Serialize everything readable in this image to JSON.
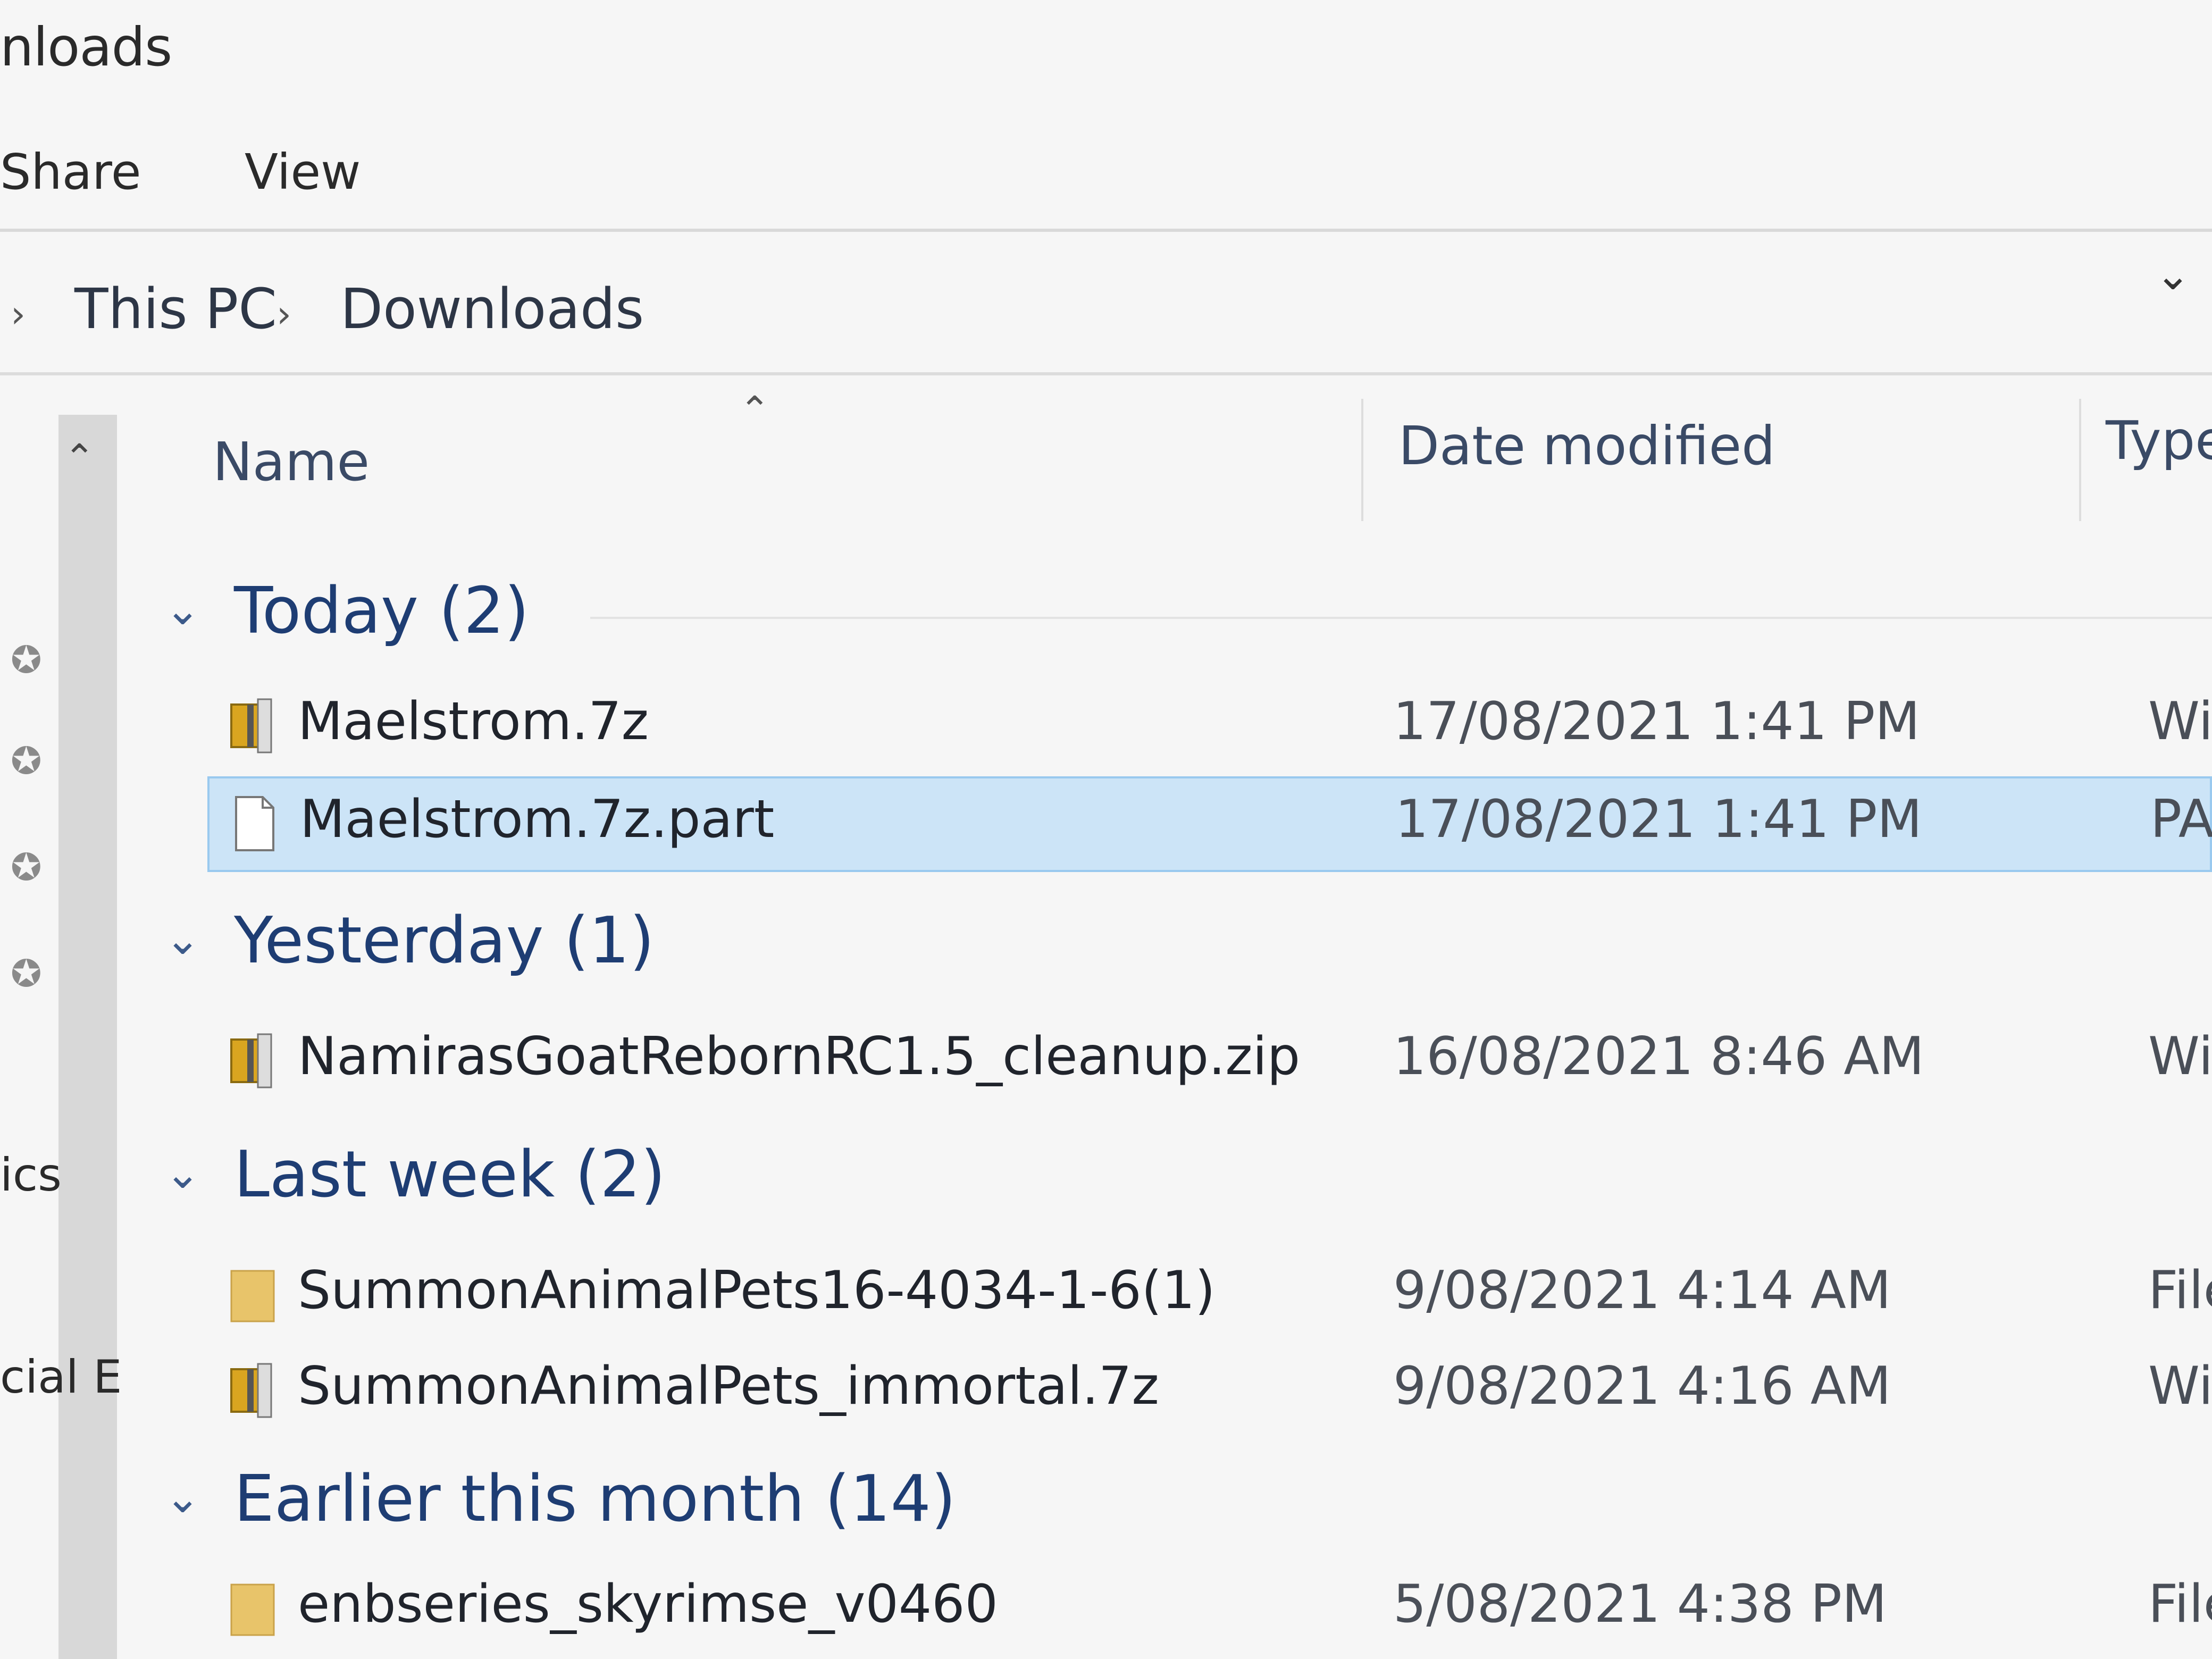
{
  "window": {
    "title": "nloads"
  },
  "ribbon": {
    "tabs": [
      "Share",
      "View"
    ]
  },
  "address": {
    "crumbs": [
      "This PC",
      "Downloads"
    ]
  },
  "nav": {
    "items": [
      "ics",
      "cial E"
    ]
  },
  "columns": {
    "name": "Name",
    "date": "Date modified",
    "type": "Type"
  },
  "groups": [
    {
      "label": "Today (2)",
      "files": [
        {
          "name": "Maelstrom.7z",
          "date": "17/08/2021 1:41 PM",
          "type": "WinZ",
          "icon": "archive-icon",
          "selected": false
        },
        {
          "name": "Maelstrom.7z.part",
          "date": "17/08/2021 1:41 PM",
          "type": "PART",
          "icon": "blank-file-icon",
          "selected": true
        }
      ]
    },
    {
      "label": "Yesterday (1)",
      "files": [
        {
          "name": "NamirasGoatRebornRC1.5_cleanup.zip",
          "date": "16/08/2021 8:46 AM",
          "type": "WinZ",
          "icon": "archive-icon",
          "selected": false
        }
      ]
    },
    {
      "label": "Last week (2)",
      "files": [
        {
          "name": "SummonAnimalPets16-4034-1-6(1)",
          "date": "9/08/2021 4:14 AM",
          "type": "File fo",
          "icon": "folder-icon",
          "selected": false
        },
        {
          "name": "SummonAnimalPets_immortal.7z",
          "date": "9/08/2021 4:16 AM",
          "type": "WinZi",
          "icon": "archive-icon",
          "selected": false
        }
      ]
    },
    {
      "label": "Earlier this month (14)",
      "files": [
        {
          "name": "enbseries_skyrimse_v0460",
          "date": "5/08/2021 4:38 PM",
          "type": "File fo",
          "icon": "folder-icon",
          "selected": false
        }
      ]
    }
  ],
  "colors": {
    "selection": "#cce4f7",
    "selection_border": "#99c9ef",
    "group_text": "#1e3d73",
    "folder": "#e8c46a",
    "archive": "#d9a520"
  }
}
